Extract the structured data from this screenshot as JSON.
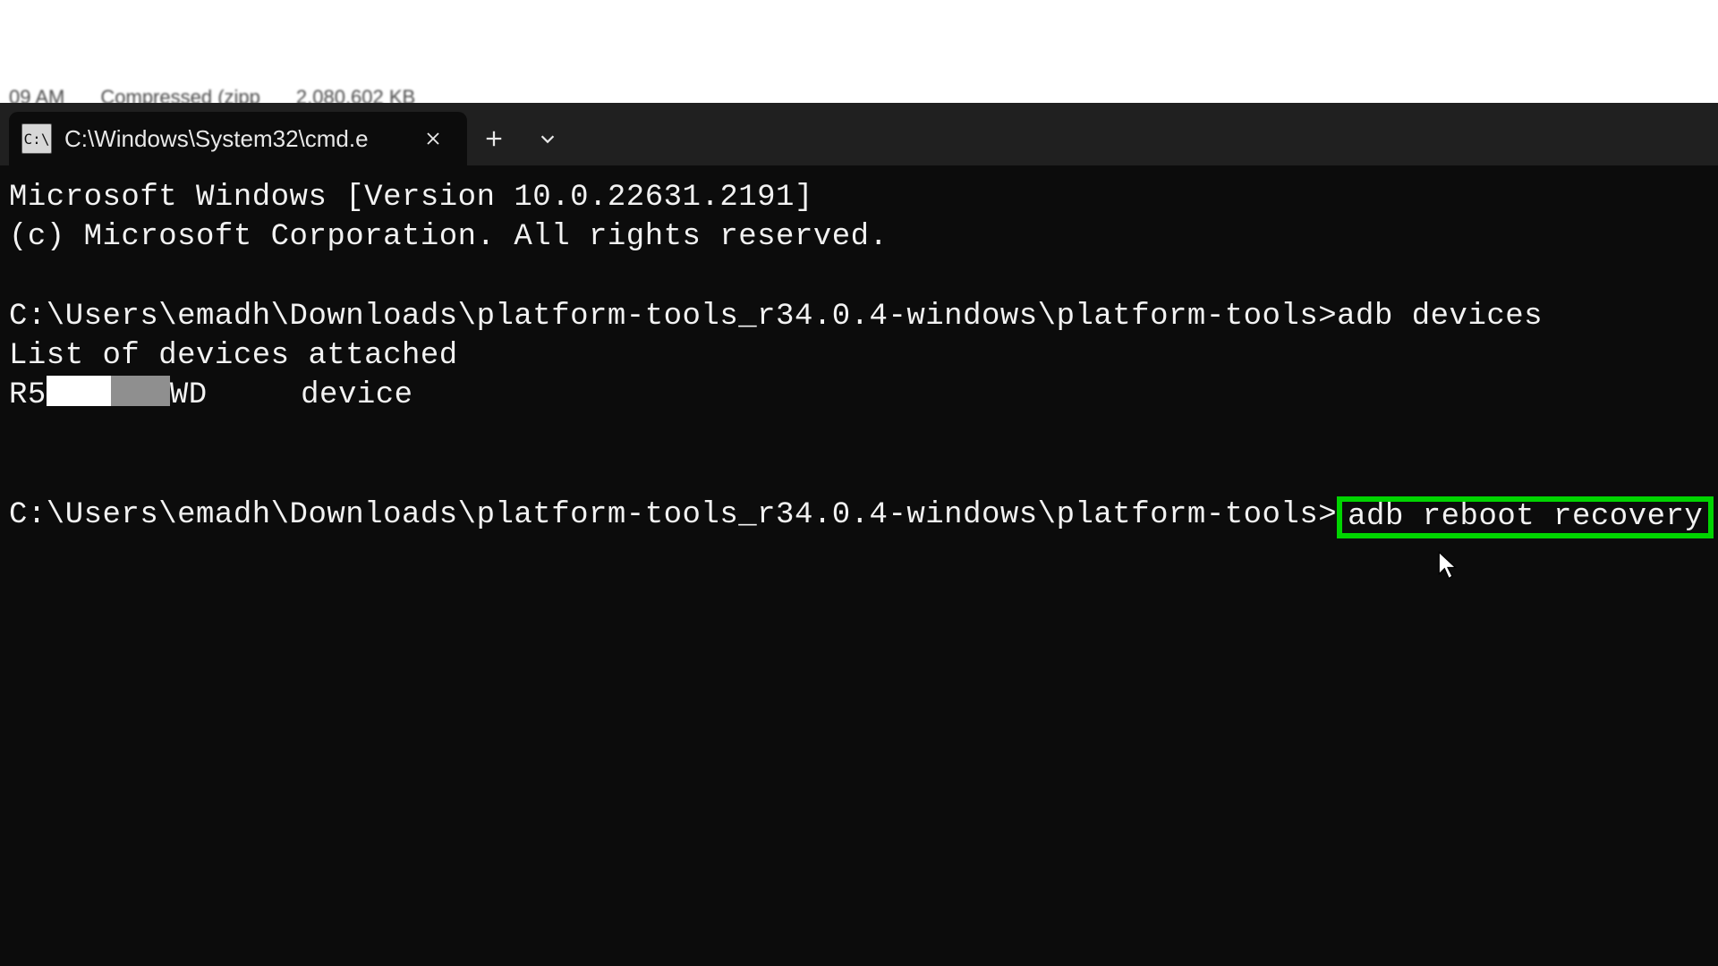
{
  "background": {
    "time": "09 AM",
    "type": "Compressed (zipp",
    "size": "2,080,602 KB"
  },
  "tab": {
    "icon_text": "C:\\",
    "title": "C:\\Windows\\System32\\cmd.e"
  },
  "terminal": {
    "banner1": "Microsoft Windows [Version 10.0.22631.2191]",
    "banner2": "(c) Microsoft Corporation. All rights reserved.",
    "prompt": "C:\\Users\\emadh\\Downloads\\platform-tools_r34.0.4-windows\\platform-tools>",
    "cmd1": "adb devices",
    "out1": "List of devices attached",
    "dev_prefix": "R5",
    "dev_suffix": "WD",
    "dev_status": "device",
    "cmd2": "adb reboot recovery"
  }
}
